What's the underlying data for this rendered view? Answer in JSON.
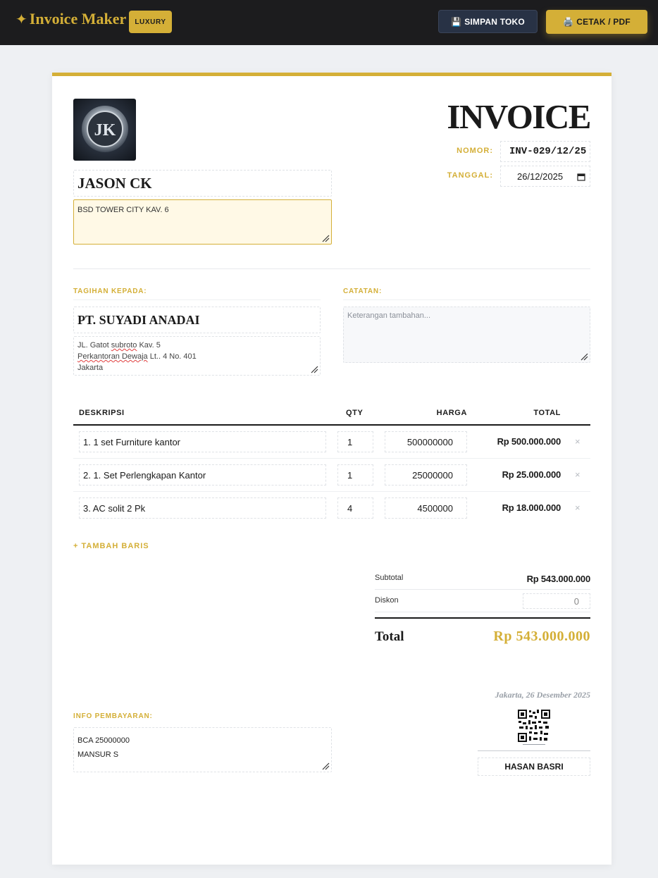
{
  "app": {
    "brand_star": "✦",
    "brand_name": "Invoice Maker",
    "badge": "LUXURY",
    "save_icon": "💾",
    "save_label": "SIMPAN TOKO",
    "print_icon": "🖨️",
    "print_label": "CETAK / PDF"
  },
  "colors": {
    "accent_gold": "#d4af37",
    "topbar_bg": "#1c1c1e",
    "save_btn_bg": "#283245"
  },
  "seller": {
    "logo_text": "JK",
    "name": "JASON CK",
    "address": "BSD TOWER CITY KAV. 6"
  },
  "invoice": {
    "title": "INVOICE",
    "nomor_label": "NOMOR:",
    "nomor": "INV-029/12/25",
    "tanggal_label": "TANGGAL:",
    "tanggal": "26/12/2025"
  },
  "client": {
    "section_label": "TAGIHAN KEPADA:",
    "name": "PT. SUYADI ANADAI",
    "address_line1_a": "JL. Gatot ",
    "address_line1_b": "subroto",
    "address_line1_c": " Kav. 5",
    "address_line2_a": "Perkantoran Dewaja",
    "address_line2_b": " Lt.. 4 No. 401",
    "address_line3": "Jakarta"
  },
  "notes": {
    "section_label": "CATATAN:",
    "placeholder": "Keterangan tambahan..."
  },
  "table": {
    "headers": {
      "desc": "DESKRIPSI",
      "qty": "QTY",
      "harga": "HARGA",
      "total": "TOTAL"
    },
    "rows": [
      {
        "desc": "1. 1 set Furniture kantor",
        "qty": "1",
        "harga": "500000000",
        "total": "Rp 500.000.000",
        "delete": "×"
      },
      {
        "desc": "2. 1. Set Perlengkapan Kantor",
        "qty": "1",
        "harga": "25000000",
        "total": "Rp 25.000.000",
        "delete": "×"
      },
      {
        "desc": "3. AC solit 2 Pk",
        "qty": "4",
        "harga": "4500000",
        "total": "Rp 18.000.000",
        "delete": "×"
      }
    ],
    "add_row": "+ TAMBAH BARIS"
  },
  "summary": {
    "subtotal_label": "Subtotal",
    "subtotal": "Rp 543.000.000",
    "diskon_label": "Diskon",
    "diskon": "0",
    "total_label": "Total",
    "total": "Rp 543.000.000"
  },
  "payment": {
    "section_label": "INFO PEMBAYARAN:",
    "line1": "BCA 25000000",
    "line2": "MANSUR S"
  },
  "signature": {
    "place_date": "Jakarta, 26 Desember 2025",
    "name": "HASAN BASRI"
  }
}
